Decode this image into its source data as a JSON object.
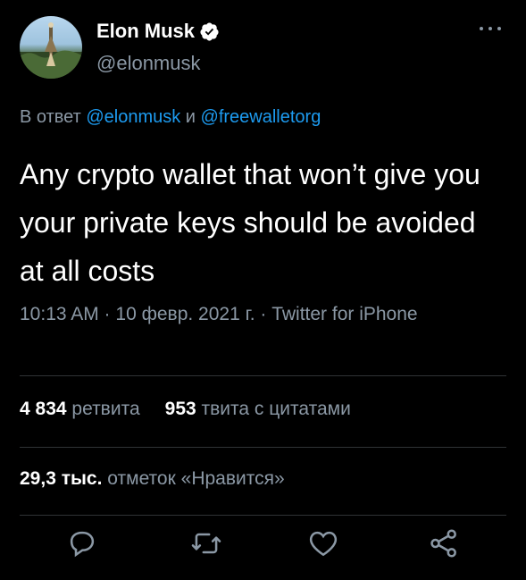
{
  "author": {
    "name": "Elon Musk",
    "handle": "@elonmusk",
    "verified": true
  },
  "reply": {
    "prefix": "В ответ",
    "mention1": "@elonmusk",
    "conjunction": "и",
    "mention2": "@freewalletorg"
  },
  "tweet": {
    "text": "Any crypto wallet that won’t give you your private keys should be avoided at all costs"
  },
  "meta": {
    "line": "10:13 AM · 10 февр. 2021 г. · Twitter for iPhone"
  },
  "stats": {
    "retweets_count": "4 834",
    "retweets_label": "ретвита",
    "quotes_count": "953",
    "quotes_label": "твита с цитатами",
    "likes_count": "29,3 тыс.",
    "likes_label": "отметок «Нравится»"
  },
  "actions": [
    {
      "name": "reply",
      "icon": "comment-icon"
    },
    {
      "name": "retweet",
      "icon": "retweet-icon"
    },
    {
      "name": "like",
      "icon": "heart-icon"
    },
    {
      "name": "share",
      "icon": "share-icon"
    }
  ],
  "colors": {
    "background": "#000000",
    "text": "#ffffff",
    "secondary": "#8b98a5",
    "link": "#1d9bf0",
    "divider": "#2f3336"
  }
}
